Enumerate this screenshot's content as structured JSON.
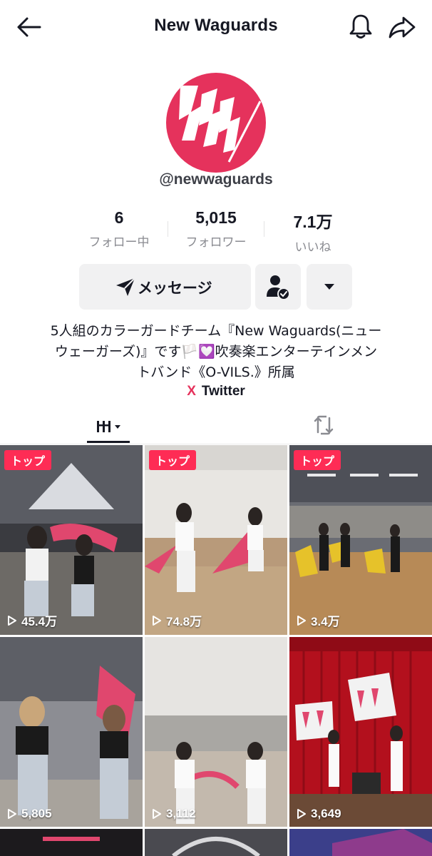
{
  "header": {
    "title": "New Waguards",
    "back_icon": "arrow-left-icon",
    "bell_icon": "bell-icon",
    "share_icon": "share-icon"
  },
  "profile": {
    "handle": "@newwaguards",
    "avatar_color": "#e5325c",
    "stats": [
      {
        "value": "6",
        "label": "フォロー中"
      },
      {
        "value": "5,015",
        "label": "フォロワー"
      },
      {
        "value": "7.1万",
        "label": "いいね"
      }
    ],
    "message_button": "メッセージ",
    "bio_lines": [
      "5人組のカラーガードチーム『New Waguards(ニュー",
      "ウェーガーズ)』です🏳️💟吹奏楽エンターテインメン",
      "トバンド《O-VILS.》所属"
    ],
    "link_icon": "X",
    "link_label": "Twitter"
  },
  "tabs": {
    "videos_icon": "grid-icon",
    "repost_icon": "repost-icon"
  },
  "videos": [
    {
      "badge": "トップ",
      "views": "45.4万"
    },
    {
      "badge": "トップ",
      "views": "74.8万"
    },
    {
      "badge": "トップ",
      "views": "3.4万"
    },
    {
      "badge": "",
      "views": "5,805"
    },
    {
      "badge": "",
      "views": "3,112"
    },
    {
      "badge": "",
      "views": "3,649"
    }
  ],
  "colors": {
    "accent": "#fe2c55",
    "brand": "#e5325c"
  }
}
